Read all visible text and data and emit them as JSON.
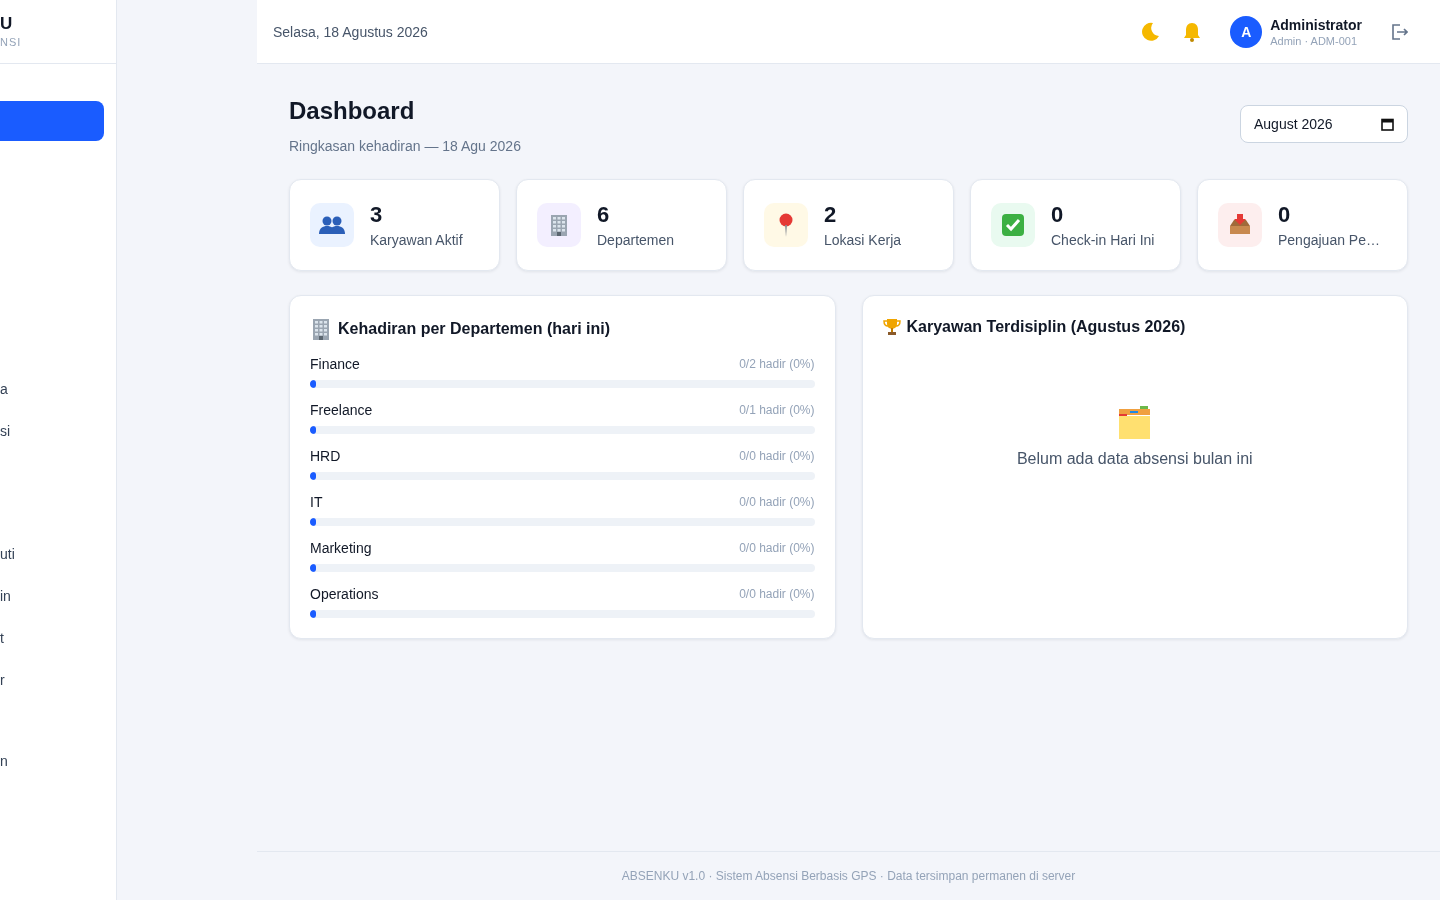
{
  "sidebar": {
    "brand": "U",
    "brand_subtitle": "NSI",
    "items": [
      {
        "selected": true
      },
      {
        "label": "a",
        "selected": false
      },
      {
        "label": "si",
        "selected": false
      },
      {
        "label": "uti",
        "selected": false
      },
      {
        "label": "in",
        "selected": false
      },
      {
        "label": "t",
        "selected": false
      },
      {
        "label": "r",
        "selected": false
      },
      {
        "label": "n",
        "selected": false
      }
    ]
  },
  "topbar": {
    "date": "Selasa, 18 Agustus 2026",
    "user": {
      "initial": "A",
      "name": "Administrator",
      "role": "Admin · ADM-001"
    }
  },
  "header": {
    "title": "Dashboard",
    "subtitle": "Ringkasan kehadiran — 18 Agu 2026",
    "month_picker": "August 2026"
  },
  "stats": [
    {
      "kind": "people",
      "value": "3",
      "label": "Karyawan Aktif",
      "color": "#eaf2ff"
    },
    {
      "kind": "building",
      "value": "6",
      "label": "Departemen",
      "color": "#f3efff"
    },
    {
      "kind": "pin",
      "value": "2",
      "label": "Lokasi Kerja",
      "color": "#fff9e6"
    },
    {
      "kind": "check",
      "value": "0",
      "label": "Check-in Hari Ini",
      "color": "#e9faf0"
    },
    {
      "kind": "inbox",
      "value": "0",
      "label": "Pengajuan Pe…",
      "color": "#fdeeee"
    }
  ],
  "department_panel": {
    "title": "Kehadiran per Departemen (hari ini)",
    "rows": [
      {
        "name": "Finance",
        "reading": "0/2 hadir (0%)",
        "level": 0
      },
      {
        "name": "Freelance",
        "reading": "0/1 hadir (0%)",
        "level": 0
      },
      {
        "name": "HRD",
        "reading": "0/0 hadir (0%)",
        "level": 0
      },
      {
        "name": "IT",
        "reading": "0/0 hadir (0%)",
        "level": 0
      },
      {
        "name": "Marketing",
        "reading": "0/0 hadir (0%)",
        "level": 0
      },
      {
        "name": "Operations",
        "reading": "0/0 hadir (0%)",
        "level": 0
      }
    ]
  },
  "discipline_panel": {
    "title": "Karyawan Terdisiplin (Agustus 2026)",
    "empty_message": "Belum ada data absensi bulan ini"
  },
  "footer": "ABSENKU v1.0 · Sistem Absensi Berbasis GPS · Data tersimpan permanen di server"
}
